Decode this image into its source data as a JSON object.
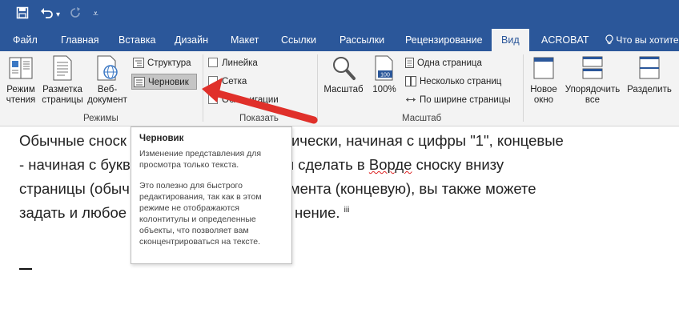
{
  "qat": {
    "save_icon": "save-icon",
    "undo_icon": "undo-icon",
    "undo_dropdown": "▾",
    "redo_icon": "redo-icon",
    "customize": "⩡"
  },
  "tabs": [
    "Файл",
    "Главная",
    "Вставка",
    "Дизайн",
    "Макет",
    "Ссылки",
    "Рассылки",
    "Рецензирование",
    "Вид",
    "ACROBAT"
  ],
  "active_tab": "Вид",
  "tell_me": "Что вы хотите",
  "ribbon": {
    "modes": {
      "read_mode": "Режим\nчтения",
      "print_layout": "Разметка\nстраницы",
      "web_layout": "Веб-\nдокумент",
      "outline": "Структура",
      "draft": "Черновик",
      "group_label": "Режимы"
    },
    "show": {
      "ruler": "Линейка",
      "grid": "Сетка",
      "nav_pane_partial": "Обл    игации",
      "group_label": "Показать"
    },
    "zoom": {
      "zoom": "Масштаб",
      "hundred": "100%",
      "hundred_icon_label": "100",
      "one_page": "Одна страница",
      "multiple_pages": "Несколько страниц",
      "page_width": "По ширине страницы",
      "group_label": "Масштаб"
    },
    "window": {
      "new_window": "Новое\nокно",
      "arrange_all": "Упорядочить\nвсе",
      "split": "Разделить"
    }
  },
  "document": {
    "line1_a": "Обычные сноск",
    "line1_b": "ически, начиная с цифры \"1\", концевые",
    "line2_a": "- начиная с букв",
    "line2_b": "ая сделать в ",
    "line2_word": "Ворде",
    "line2_c": " сноску внизу",
    "line3_a": "страницы (обыч",
    "line3_b": "мента (концевую), вы также можете",
    "line4_a": "задать и любое",
    "line4_b": "нение.",
    "line4_sup": "iii"
  },
  "tooltip": {
    "title": "Черновик",
    "p1": "Изменение представления для просмотра только текста.",
    "p2": "Это полезно для быстрого редактирования, так как в этом режиме не отображаются колонтитулы и определенные объекты, что позволяет вам сконцентрироваться на тексте."
  },
  "colors": {
    "brand": "#2b579a",
    "ribbon_bg": "#f3f3f3",
    "arrow": "#e0302a"
  }
}
